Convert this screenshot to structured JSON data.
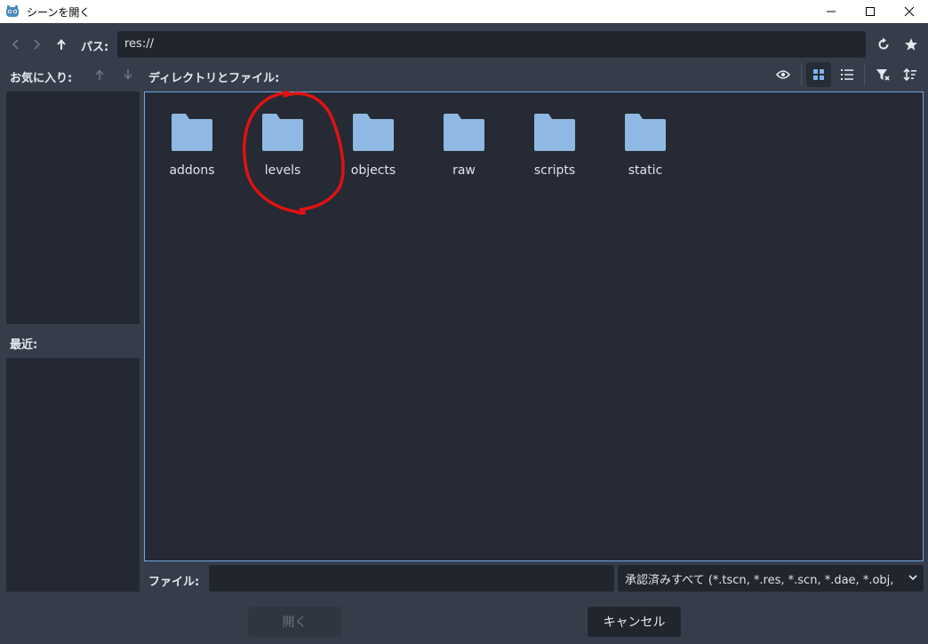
{
  "window": {
    "title": "シーンを開く"
  },
  "toolbar": {
    "path_label": "パス:",
    "path_value": "res://"
  },
  "favorites": {
    "label": "お気に入り:"
  },
  "recent": {
    "label": "最近:"
  },
  "files": {
    "label": "ディレクトリとファイル:",
    "folders": [
      {
        "name": "addons"
      },
      {
        "name": "levels"
      },
      {
        "name": "objects"
      },
      {
        "name": "raw"
      },
      {
        "name": "scripts"
      },
      {
        "name": "static"
      }
    ]
  },
  "bottom": {
    "file_label": "ファイル:",
    "file_value": "",
    "filter_value": "承認済みすべて (*.tscn, *.res, *.scn, *.dae, *.obj,",
    "open_label": "開く",
    "cancel_label": "キャンセル"
  },
  "colors": {
    "folder": "#8fb9e2",
    "accent": "#6ea9e4",
    "annotation": "#e01212"
  },
  "icons": [
    "godot-logo-icon",
    "back-icon",
    "forward-icon",
    "up-icon",
    "refresh-icon",
    "star-icon",
    "move-up-icon",
    "move-down-icon",
    "eye-icon",
    "grid-view-icon",
    "list-view-icon",
    "filter-icon",
    "sort-icon",
    "chevron-down-icon",
    "folder-icon"
  ]
}
